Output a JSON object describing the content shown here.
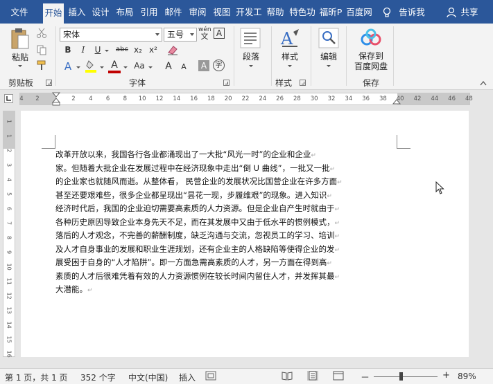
{
  "tabs": [
    {
      "label": "文件",
      "active": false
    },
    {
      "label": "开始",
      "active": true
    },
    {
      "label": "插入",
      "active": false
    },
    {
      "label": "设计",
      "active": false
    },
    {
      "label": "布局",
      "active": false
    },
    {
      "label": "引用",
      "active": false
    },
    {
      "label": "邮件",
      "active": false
    },
    {
      "label": "审阅",
      "active": false
    },
    {
      "label": "视图",
      "active": false
    },
    {
      "label": "开发工",
      "active": false
    },
    {
      "label": "帮助",
      "active": false
    },
    {
      "label": "特色功",
      "active": false
    },
    {
      "label": "福昕P",
      "active": false
    },
    {
      "label": "百度网",
      "active": false
    }
  ],
  "tellme": "告诉我",
  "share": "共享",
  "ribbon": {
    "clipboard": {
      "paste": "粘贴",
      "label": "剪贴板"
    },
    "font": {
      "name": "宋体",
      "size": "五号",
      "wen": "wén",
      "A_box": "A",
      "bold": "B",
      "italic": "I",
      "underline": "U",
      "strike": "abc",
      "sub": "x₂",
      "sup": "x²",
      "grow": "A",
      "shrink": "A",
      "aa": "Aa",
      "shade_A": "A",
      "circle": "字",
      "label": "字体"
    },
    "paragraph": {
      "label": "段落"
    },
    "styles": {
      "button": "样式",
      "label": "样式"
    },
    "editing": {
      "button": "编辑"
    },
    "save": {
      "line1": "保存到",
      "line2": "百度网盘",
      "label": "保存"
    }
  },
  "ruler": {
    "ticks": [
      "4",
      "2",
      "2",
      "4",
      "6",
      "8",
      "10",
      "12",
      "14",
      "16",
      "18",
      "20",
      "22",
      "24",
      "26",
      "28",
      "30",
      "32",
      "34",
      "36",
      "38",
      "40",
      "42",
      "44",
      "46",
      "48"
    ],
    "vticks": [
      "1",
      "1",
      "2",
      "3",
      "4",
      "5",
      "6",
      "7",
      "8",
      "9",
      "10",
      "11",
      "12",
      "13",
      "14",
      "15",
      "16"
    ]
  },
  "document": {
    "lines": [
      "改革开放以来，我国各行各业都涌现出了一大批“风光一时”的企业和企业",
      "家。但随着大批企业在发展过程中在经济现象中走出“倒 U 曲线”，一批又一批",
      "的企业家也就随风而逝。从整体看，  民营企业的发展状况比国营企业在许多方面",
      "甚至还要艰难些，很多企业都呈现出“昙花一现，步履维艰”的现象。进入知识",
      "经济时代后，我国的企业迫切需要高素质的人力资源。但是企业自产生时就由于",
      "各种历史原因导致企业本身先天不足，而在其发展中又由于低水平的惯例模式，",
      "落后的人才观念，不完善的薪酬制度，缺乏沟通与交流，忽视员工的学习、培训",
      "及人才自身事业的发展和职业生涯规划，还有企业主的人格缺陷等使得企业的发",
      "展受困于自身的“人才陷阱”。即一方面急需高素质的人才，另一方面在得到高",
      "素质的人才后很难凭着有效的人力资源惯例在较长时间内留住人才，并发挥其最",
      "大潜能。"
    ],
    "para_mark": "↵"
  },
  "status": {
    "page": "第 1 页，共 1 页",
    "words": "352 个字",
    "lang": "中文(中国)",
    "mode": "插入",
    "zoom_percent": "89%",
    "zoom_level": 0.89,
    "minus": "－",
    "plus": "+"
  },
  "colors": {
    "accent": "#2b579a",
    "highlight": "#ffff00",
    "font_color": "#c00000"
  }
}
